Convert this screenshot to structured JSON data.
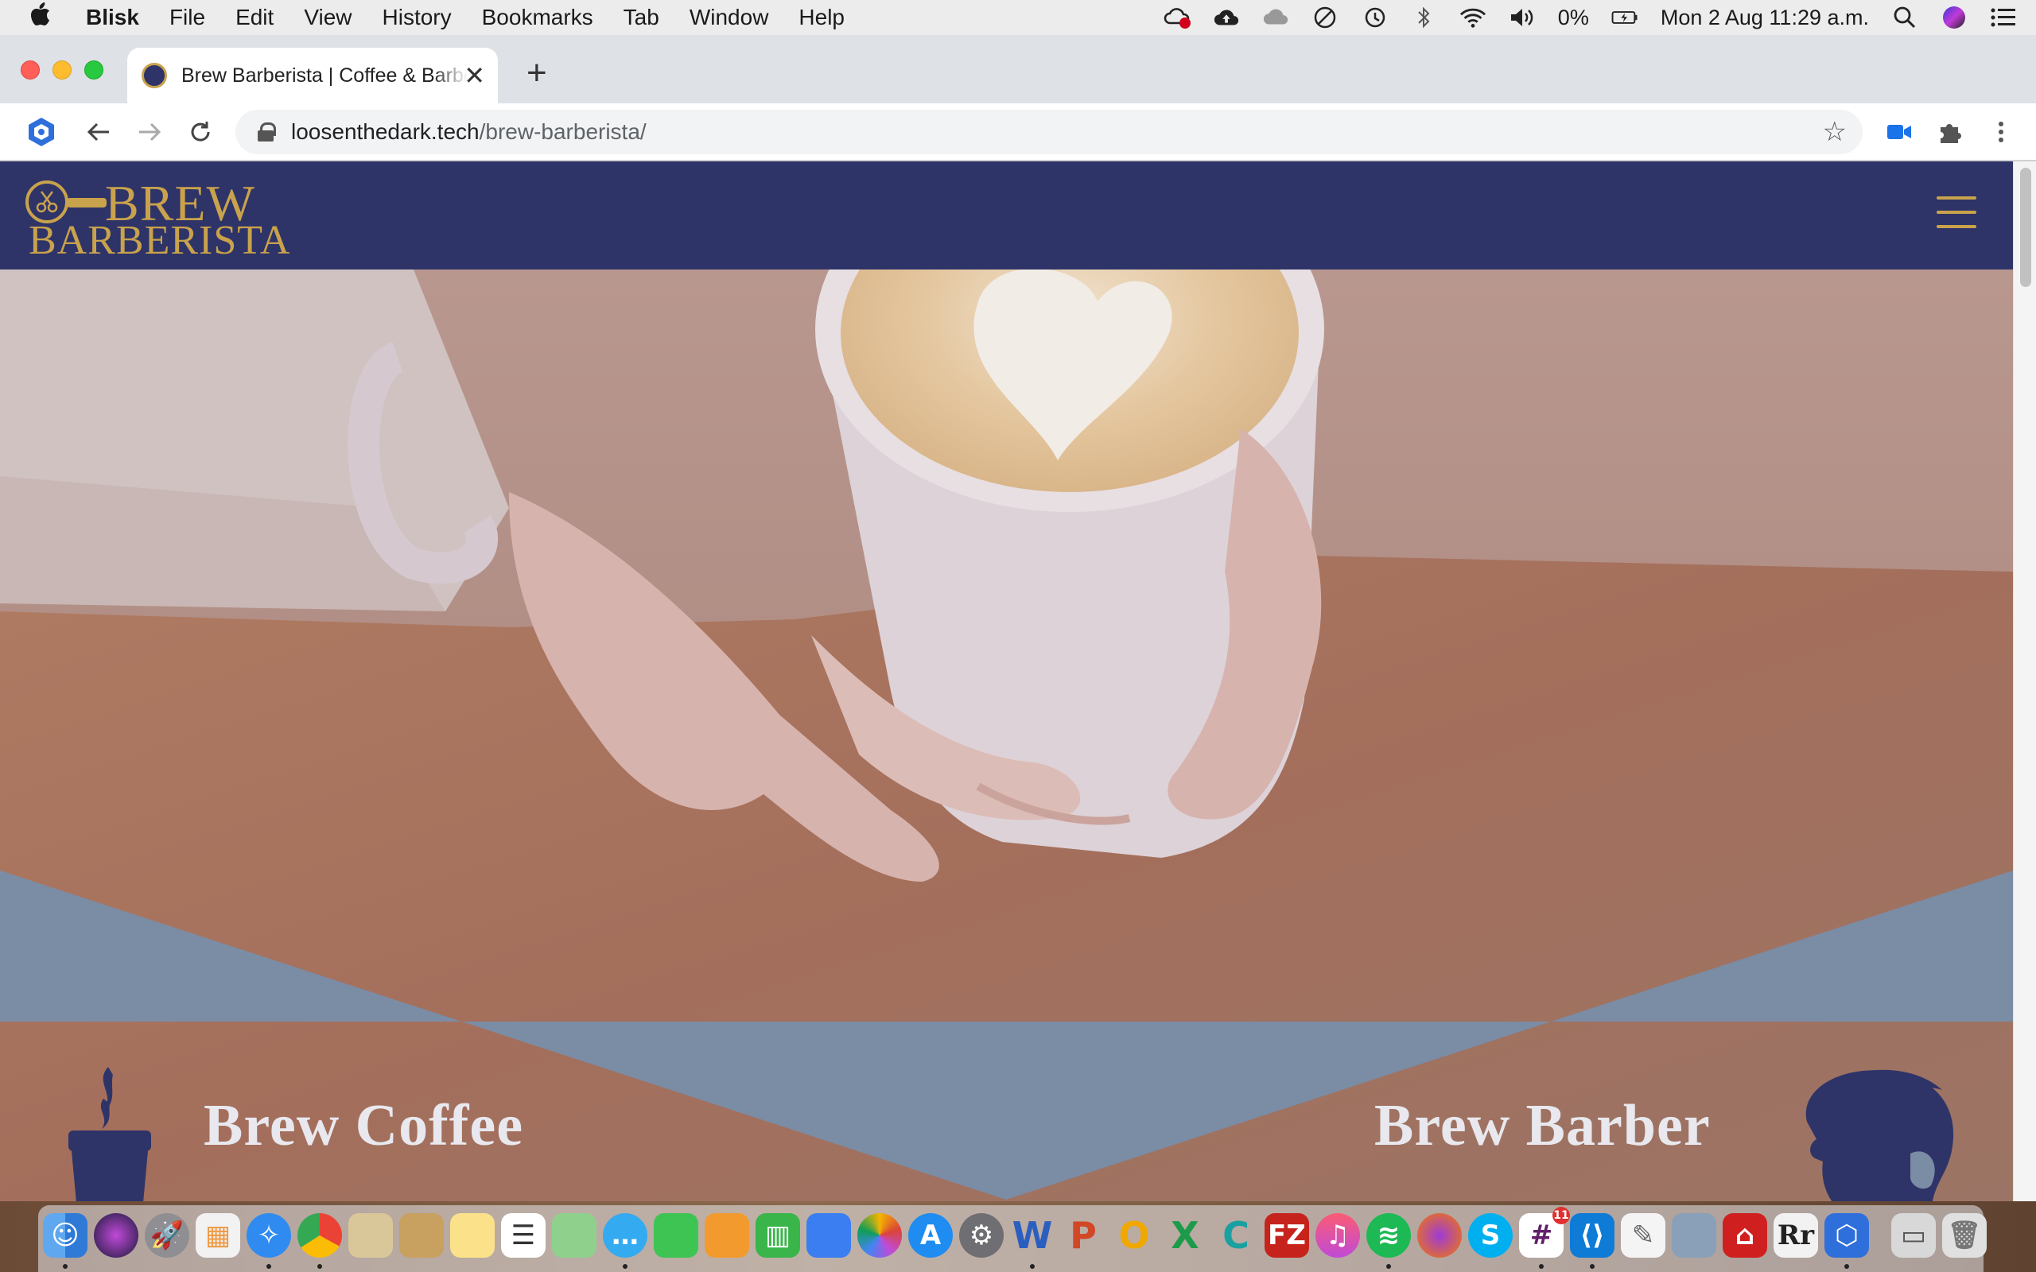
{
  "menubar": {
    "app_name": "Blisk",
    "items": [
      "File",
      "Edit",
      "View",
      "History",
      "Bookmarks",
      "Tab",
      "Window",
      "Help"
    ],
    "battery": "0%",
    "datetime": "Mon 2 Aug  11:29 a.m."
  },
  "browser": {
    "tab_title": "Brew Barberista | Coffee & Barber",
    "url_host": "loosenthedark.tech",
    "url_path": "/brew-barberista/"
  },
  "site": {
    "logo_line1": "BREW",
    "logo_line2": "BARBERISTA",
    "brand_color": "#2e3468",
    "accent_color": "#c9a24c",
    "left_label": "Brew Coffee",
    "right_label": "Brew Barber"
  },
  "dock": {
    "apps": [
      "Finder",
      "Siri",
      "Launchpad",
      "Launchpad Grid",
      "Safari",
      "Chrome",
      "Preview",
      "Notes Book",
      "Notes",
      "Reminders",
      "Maps",
      "Messages",
      "FaceTime",
      "Pages Editor",
      "Numbers",
      "Keynote",
      "Photos",
      "App Store",
      "System Preferences",
      "Word",
      "PowerPoint",
      "Outlook",
      "Excel",
      "Coda",
      "FileZilla",
      "Music",
      "Spotify",
      "Firefox",
      "Skype",
      "Slack",
      "VS Code",
      "TextEdit",
      "Image Capture",
      "Acrobat",
      "Rr",
      "Blisk",
      "Screenshot",
      "Trash"
    ],
    "slack_badge": "11"
  }
}
